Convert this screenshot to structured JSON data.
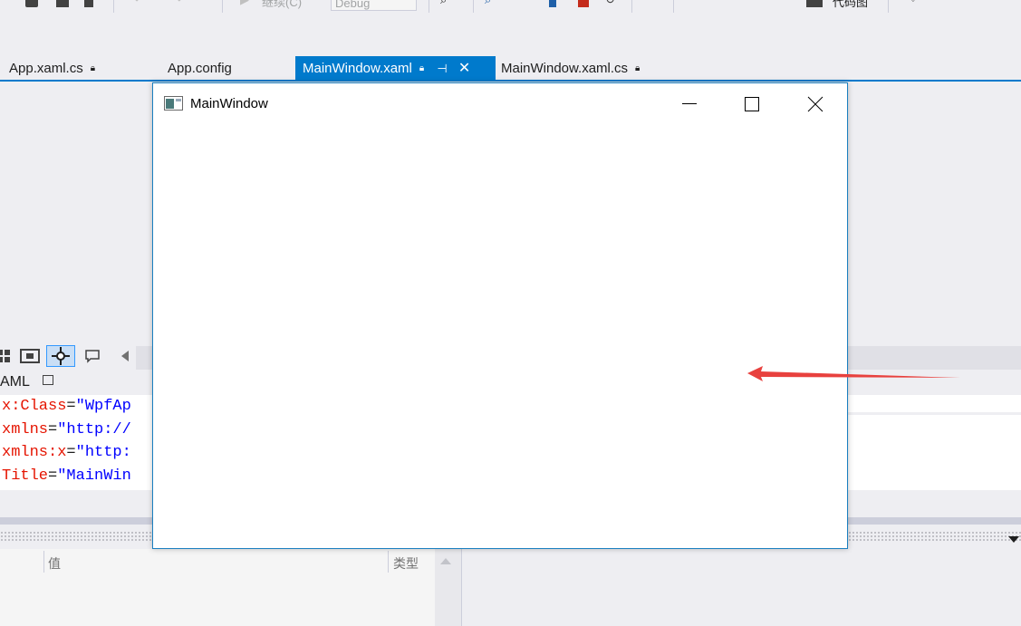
{
  "toolbar": {
    "continue_label": "继续(C)",
    "config_value": "Debug",
    "diag_label": "代码图"
  },
  "tabs": [
    {
      "label": "App.xaml.cs",
      "active": false
    },
    {
      "label": "App.config",
      "active": false
    },
    {
      "label": "MainWindow.xaml",
      "active": true
    },
    {
      "label": "MainWindow.xaml.cs",
      "active": false
    }
  ],
  "xaml": {
    "tab_label": "AML",
    "lines": [
      {
        "attr": "x:Class",
        "value": "\"WpfAp"
      },
      {
        "attr": "xmlns",
        "value": "\"http://"
      },
      {
        "attr": "xmlns:x",
        "value": "\"http:"
      },
      {
        "attr": "Title",
        "value": "\"MainWin"
      }
    ]
  },
  "properties": {
    "col_value": "值",
    "col_type": "类型"
  },
  "app_window": {
    "title": "MainWindow"
  },
  "colors": {
    "accent": "#007acc",
    "arrow": "#e8413e"
  }
}
